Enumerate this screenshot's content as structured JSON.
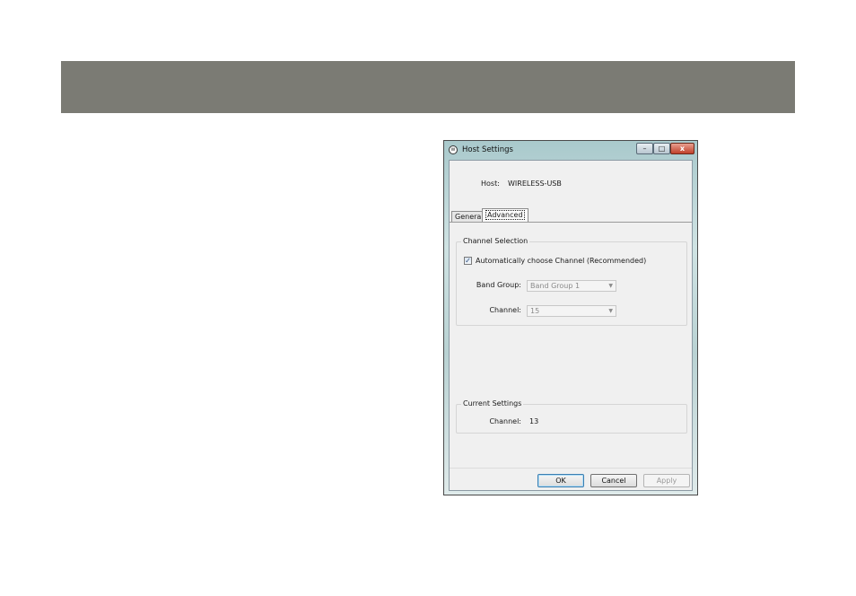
{
  "window": {
    "title": "Host Settings",
    "icon": "wireless-usb-icon",
    "controls": {
      "minimize": "–",
      "maximize": "□",
      "close": "x"
    }
  },
  "host": {
    "label": "Host:",
    "value": "WIRELESS-USB"
  },
  "tabs": [
    {
      "label": "General",
      "selected": false
    },
    {
      "label": "Advanced",
      "selected": true
    }
  ],
  "channel_selection": {
    "legend": "Channel Selection",
    "auto_checkbox": {
      "label": "Automatically choose Channel (Recommended)",
      "checked": true
    },
    "band_group": {
      "label": "Band Group:",
      "value": "Band Group 1",
      "disabled": true
    },
    "channel": {
      "label": "Channel:",
      "value": "15",
      "disabled": true
    }
  },
  "current_settings": {
    "legend": "Current Settings",
    "channel_label": "Channel:",
    "channel_value": "13"
  },
  "buttons": {
    "ok": "OK",
    "cancel": "Cancel",
    "apply": "Apply"
  },
  "colors": {
    "header_bar": "#7b7b74",
    "dialog_background": "#f0f0f0",
    "ok_button_border": "#3c7fb1"
  }
}
